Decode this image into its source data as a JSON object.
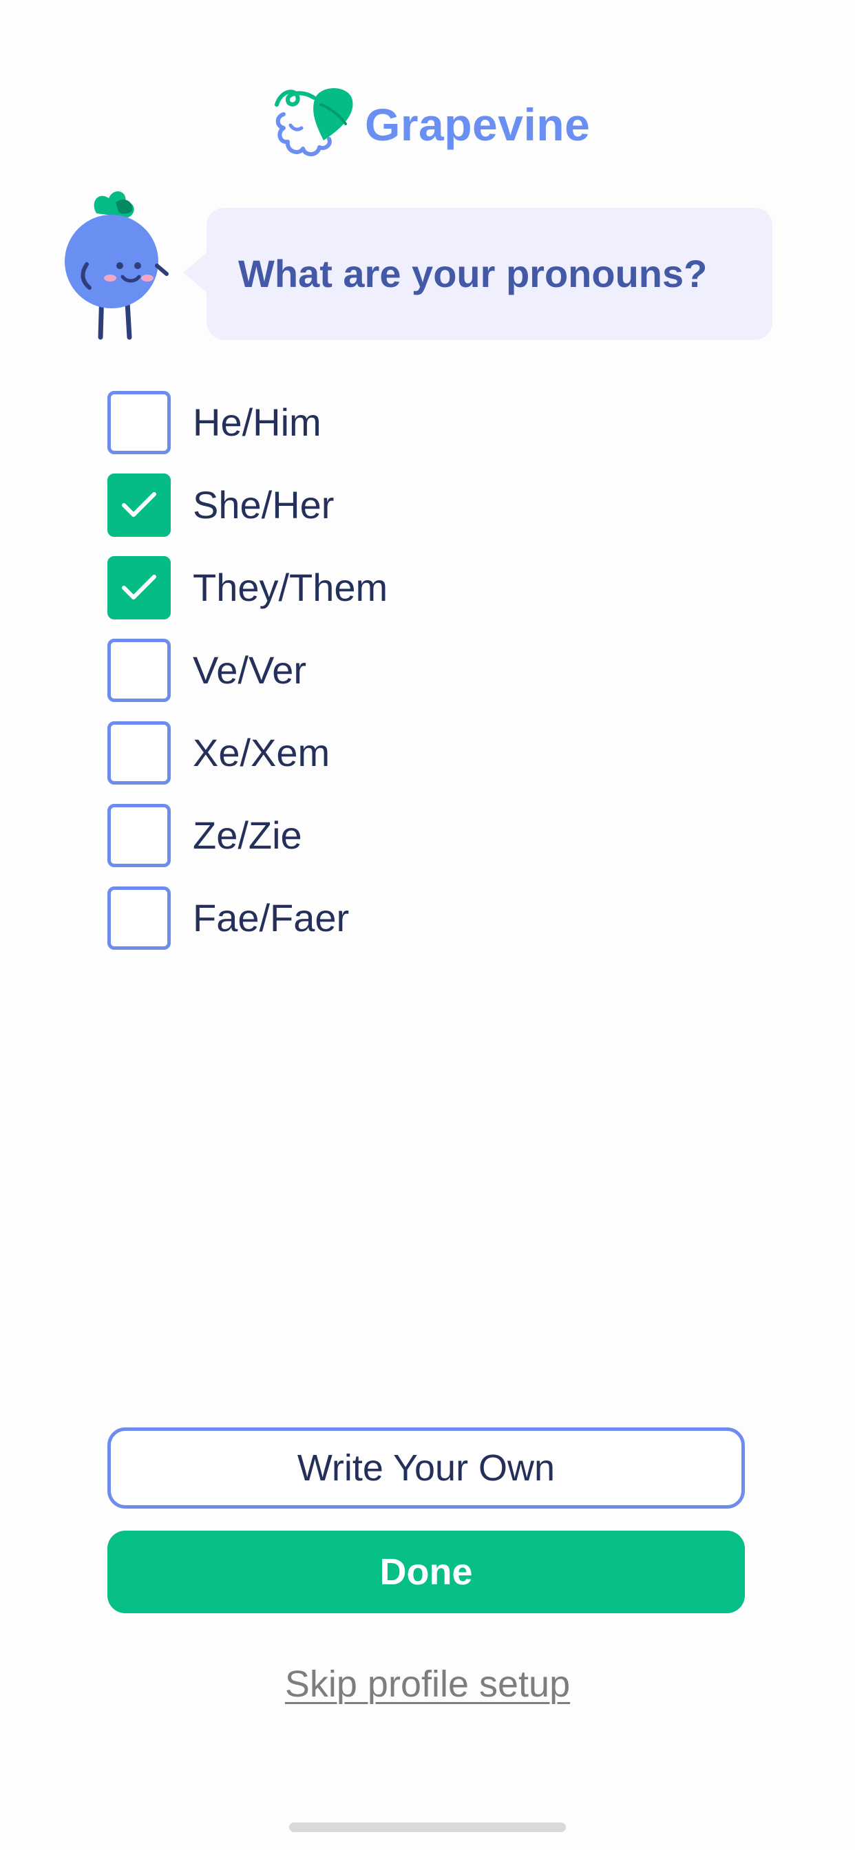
{
  "app": {
    "name": "Grapevine"
  },
  "prompt": {
    "question": "What are your pronouns?"
  },
  "options": [
    {
      "label": "He/Him",
      "checked": false
    },
    {
      "label": "She/Her",
      "checked": true
    },
    {
      "label": "They/Them",
      "checked": true
    },
    {
      "label": "Ve/Ver",
      "checked": false
    },
    {
      "label": "Xe/Xem",
      "checked": false
    },
    {
      "label": "Ze/Zie",
      "checked": false
    },
    {
      "label": "Fae/Faer",
      "checked": false
    }
  ],
  "actions": {
    "write_own_label": "Write Your Own",
    "done_label": "Done",
    "skip_label": "Skip profile setup"
  },
  "icons": {
    "logo": "grape-leaf-logo-icon",
    "mascot": "blueberry-mascot-icon",
    "checkmark": "checkmark-icon"
  },
  "colors": {
    "brand_blue": "#6a8ff2",
    "heading_blue": "#4459a6",
    "bubble_bg": "#efeffd",
    "accent_green": "#05bf87",
    "text_dark": "#243059",
    "link_gray": "#7d7d7d"
  }
}
